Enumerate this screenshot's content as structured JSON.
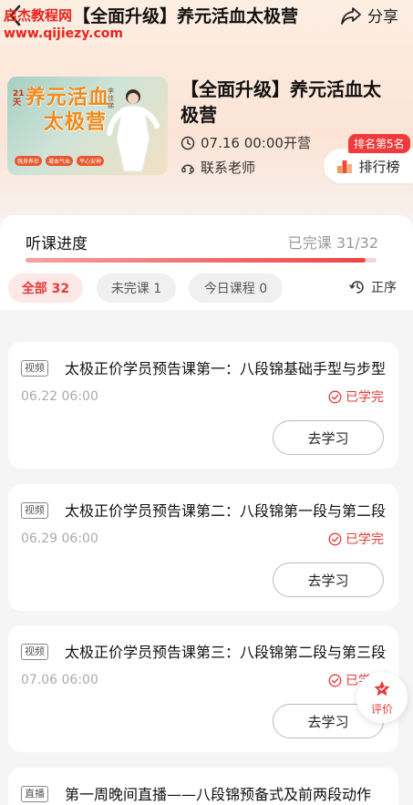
{
  "watermark": {
    "line1": "启杰教程网",
    "line2": "www.qijiezy.com"
  },
  "nav": {
    "title": "【全面升级】养元活血太极营",
    "share_label": "分享"
  },
  "cover": {
    "days": "21天",
    "title_line1": "养元活血",
    "title_line2": "太极营",
    "side_text": "李佳娣",
    "tags": [
      "强身养形",
      "凝血气血",
      "平心安神"
    ]
  },
  "course": {
    "title": "【全面升级】养元活血太极营",
    "start_time": "07.16 00:00开营",
    "contact_label": "联系老师",
    "rank_badge": "排名第5名",
    "rank_label": "排行榜"
  },
  "progress": {
    "label": "听课进度",
    "value_text": "已完课 31/32",
    "completed": 31,
    "total": 32
  },
  "filters": {
    "all_label": "全部 32",
    "unfinished_label": "未完课 1",
    "today_label": "今日课程 0",
    "sort_label": "正序"
  },
  "lessons": [
    {
      "type": "视频",
      "title": "太极正价学员预告课第一：八段锦基础手型与步型",
      "date": "06.22 06:00",
      "status": "已学完",
      "button": "去学习"
    },
    {
      "type": "视频",
      "title": "太极正价学员预告课第二：八段锦第一段与第二段",
      "date": "06.29 06:00",
      "status": "已学完",
      "button": "去学习"
    },
    {
      "type": "视频",
      "title": "太极正价学员预告课第三：八段锦第二段与第三段",
      "date": "07.06 06:00",
      "status": "已学完",
      "button": "去学习"
    },
    {
      "type": "直播",
      "title": "第一周晚间直播——八段锦预备式及前两段动作"
    }
  ],
  "review": {
    "label": "评价"
  },
  "colors": {
    "accent": "#e53a3a",
    "header_bg": "#fbe4d6"
  }
}
